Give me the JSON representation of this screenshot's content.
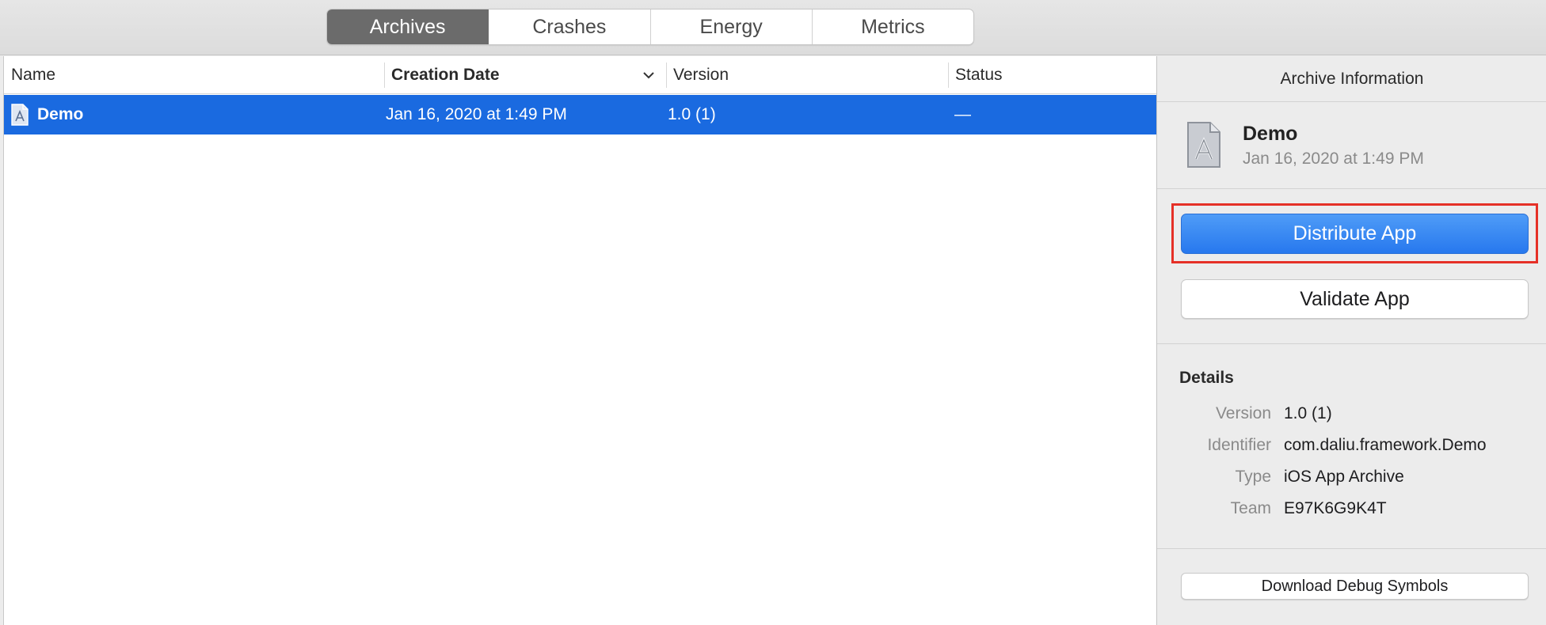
{
  "tabs": [
    {
      "label": "Archives",
      "active": true
    },
    {
      "label": "Crashes",
      "active": false
    },
    {
      "label": "Energy",
      "active": false
    },
    {
      "label": "Metrics",
      "active": false
    }
  ],
  "list": {
    "columns": {
      "name": "Name",
      "creation_date": "Creation Date",
      "version": "Version",
      "status": "Status"
    },
    "sort_indicator_icon": "chevron-down-icon",
    "rows": [
      {
        "icon": "app-archive-icon",
        "name": "Demo",
        "creation_date": "Jan 16, 2020 at 1:49 PM",
        "version": "1.0 (1)",
        "status": "—",
        "selected": true
      }
    ]
  },
  "inspector": {
    "title": "Archive Information",
    "archive_icon": "app-archive-icon",
    "name": "Demo",
    "date": "Jan 16, 2020 at 1:49 PM",
    "distribute_label": "Distribute App",
    "validate_label": "Validate App",
    "details_heading": "Details",
    "details": [
      {
        "label": "Version",
        "value": "1.0 (1)"
      },
      {
        "label": "Identifier",
        "value": "com.daliu.framework.Demo"
      },
      {
        "label": "Type",
        "value": "iOS App Archive"
      },
      {
        "label": "Team",
        "value": "E97K6G9K4T"
      }
    ],
    "download_symbols_label": "Download Debug Symbols"
  },
  "colors": {
    "selection": "#1a6ae0",
    "primary_button": "#2778ee",
    "highlight_outline": "#e53027",
    "active_tab": "#6b6b6b"
  }
}
